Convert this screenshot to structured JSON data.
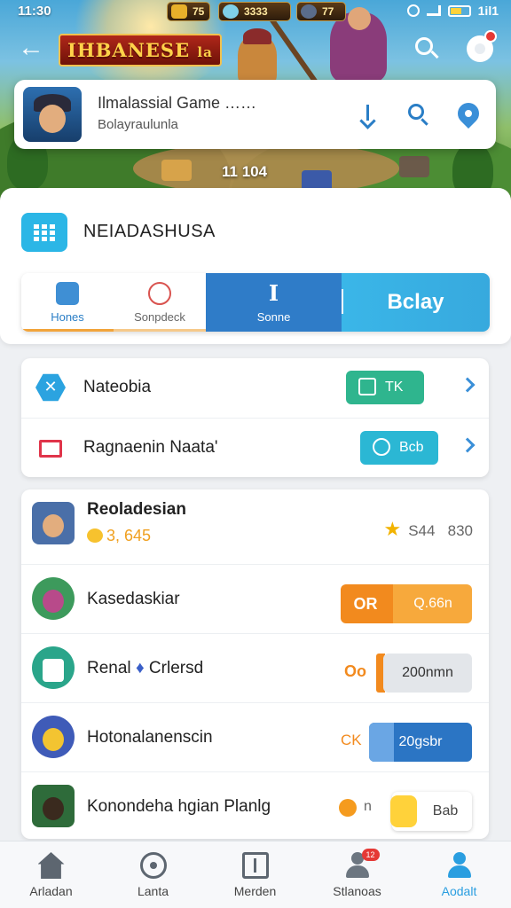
{
  "status_bar": {
    "time": "11:30",
    "resources": [
      "75",
      "3333",
      "77"
    ],
    "right_label": "1il1"
  },
  "app_bar": {
    "logo_text": "IHBANESE",
    "logo_suffix": "la"
  },
  "game_card": {
    "title": "Ilmalassial Game ……",
    "subtitle": "Bolayraulunla"
  },
  "hero_stat": "11 104",
  "section": {
    "title": "NEIADASHUSA"
  },
  "tabs": [
    {
      "label": "Hones",
      "icon": "person-icon"
    },
    {
      "label": "Sonpdeck",
      "icon": "target-icon"
    },
    {
      "label": "Sonne",
      "icon": "text-icon"
    }
  ],
  "play_label": "Bclay",
  "links": [
    {
      "name": "Nateobia",
      "pill": "TK",
      "icon": "hexagon-icon"
    },
    {
      "name": "Ragnaenin Naata'",
      "pill": "Bcb",
      "icon": "flag-icon"
    }
  ],
  "players": [
    {
      "name": "Reoladesian",
      "coins": "3, 645",
      "star_value": "S44",
      "star_value2": "830"
    },
    {
      "name": "Kasedaskiar",
      "btn_left": "OR",
      "btn_right": "Q.66n"
    },
    {
      "name": "Renal",
      "name_suffix": "Crlersd",
      "lead": "Oo",
      "btn": "200nmn"
    },
    {
      "name": "Hotonalanenscin",
      "lead": "CK",
      "btn": "20gsbr"
    },
    {
      "name": "Konondeha hgian Planlg",
      "lead": "n",
      "btn": "Bab"
    }
  ],
  "nav": [
    {
      "label": "Arladan",
      "icon": "home-icon"
    },
    {
      "label": "Lanta",
      "icon": "compass-icon"
    },
    {
      "label": "Merden",
      "icon": "book-icon"
    },
    {
      "label": "Stlanoas",
      "icon": "user-icon",
      "badge": "12"
    },
    {
      "label": "Aodalt",
      "icon": "profile-icon",
      "active": true
    }
  ],
  "colors": {
    "accent_blue": "#2f7cc8",
    "play_cyan": "#3ab6e8",
    "green": "#2fb58e",
    "orange": "#f28a1e"
  }
}
